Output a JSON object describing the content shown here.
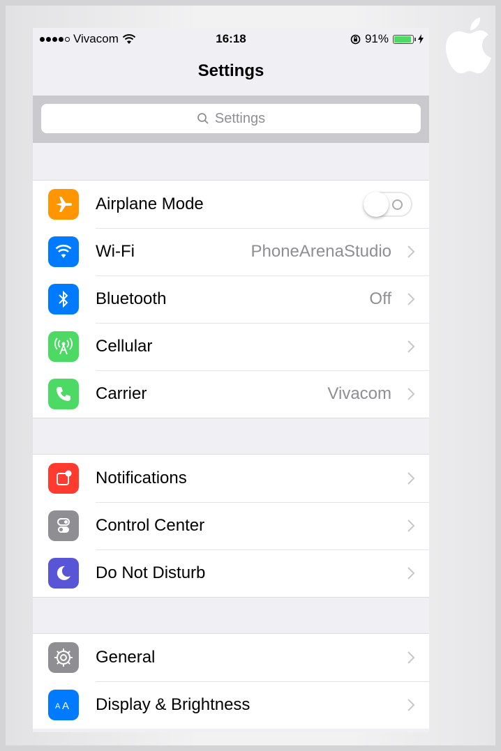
{
  "status_bar": {
    "carrier": "Vivacom",
    "time": "16:18",
    "battery_percent": "91%",
    "battery_level": 0.91,
    "signal_bars": 4,
    "icons": [
      "signal-dots-icon",
      "wifi-icon",
      "rotation-lock-icon",
      "battery-icon",
      "charging-bolt-icon"
    ]
  },
  "nav": {
    "title": "Settings"
  },
  "search": {
    "placeholder": "Settings",
    "icon": "search-icon"
  },
  "groups": [
    {
      "items": [
        {
          "label": "Airplane Mode",
          "icon": "airplane-icon",
          "color": "#ff9500",
          "toggle": true,
          "toggle_on": false
        },
        {
          "label": "Wi-Fi",
          "icon": "wifi-icon",
          "color": "#007aff",
          "value": "PhoneArenaStudio"
        },
        {
          "label": "Bluetooth",
          "icon": "bluetooth-icon",
          "color": "#007aff",
          "value": "Off"
        },
        {
          "label": "Cellular",
          "icon": "cellular-antenna-icon",
          "color": "#4cd964",
          "value": ""
        },
        {
          "label": "Carrier",
          "icon": "phone-icon",
          "color": "#4cd964",
          "value": "Vivacom"
        }
      ]
    },
    {
      "items": [
        {
          "label": "Notifications",
          "icon": "notifications-icon",
          "color": "#ff3b30"
        },
        {
          "label": "Control Center",
          "icon": "control-center-icon",
          "color": "#8e8e93"
        },
        {
          "label": "Do Not Disturb",
          "icon": "moon-icon",
          "color": "#5856d6"
        }
      ]
    },
    {
      "items": [
        {
          "label": "General",
          "icon": "gear-icon",
          "color": "#8e8e93"
        },
        {
          "label": "Display & Brightness",
          "icon": "display-brightness-icon",
          "color": "#007aff"
        }
      ]
    }
  ]
}
